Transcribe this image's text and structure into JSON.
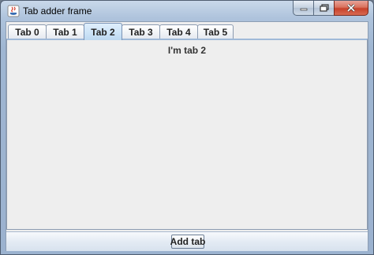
{
  "window": {
    "title": "Tab adder frame"
  },
  "tabs": [
    {
      "label": "Tab 0",
      "selected": false
    },
    {
      "label": "Tab 1",
      "selected": false
    },
    {
      "label": "Tab 2",
      "selected": true
    },
    {
      "label": "Tab 3",
      "selected": false
    },
    {
      "label": "Tab 4",
      "selected": false
    },
    {
      "label": "Tab 5",
      "selected": false
    }
  ],
  "panel": {
    "label": "I'm tab 2"
  },
  "footer": {
    "add_button_label": "Add tab"
  },
  "icons": {
    "app": "java-icon",
    "minimize": "minimize-icon",
    "maximize": "maximize-icon",
    "close": "close-icon"
  }
}
